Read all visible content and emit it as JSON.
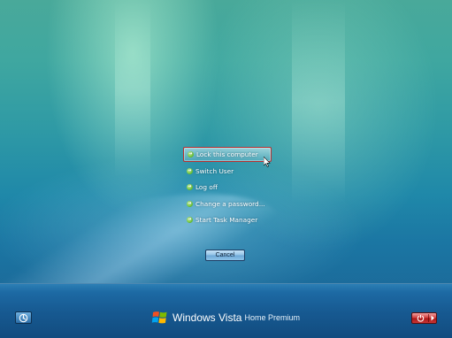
{
  "options": {
    "items": [
      {
        "label": "Lock this computer",
        "selected": true
      },
      {
        "label": "Switch User"
      },
      {
        "label": "Log off"
      },
      {
        "label": "Change a password..."
      },
      {
        "label": "Start Task Manager"
      }
    ],
    "cancel_label": "Cancel"
  },
  "brand": {
    "name": "Windows Vista",
    "edition": "Home Premium"
  },
  "icons": {
    "item_arrow": "green-arrow-icon",
    "ease_of_access": "ease-of-access-icon",
    "power": "power-icon",
    "power_menu": "chevron-right-icon",
    "logo": "windows-flag-icon"
  },
  "colors": {
    "selection_border": "#b73030",
    "power_button": "#d23b3b"
  }
}
